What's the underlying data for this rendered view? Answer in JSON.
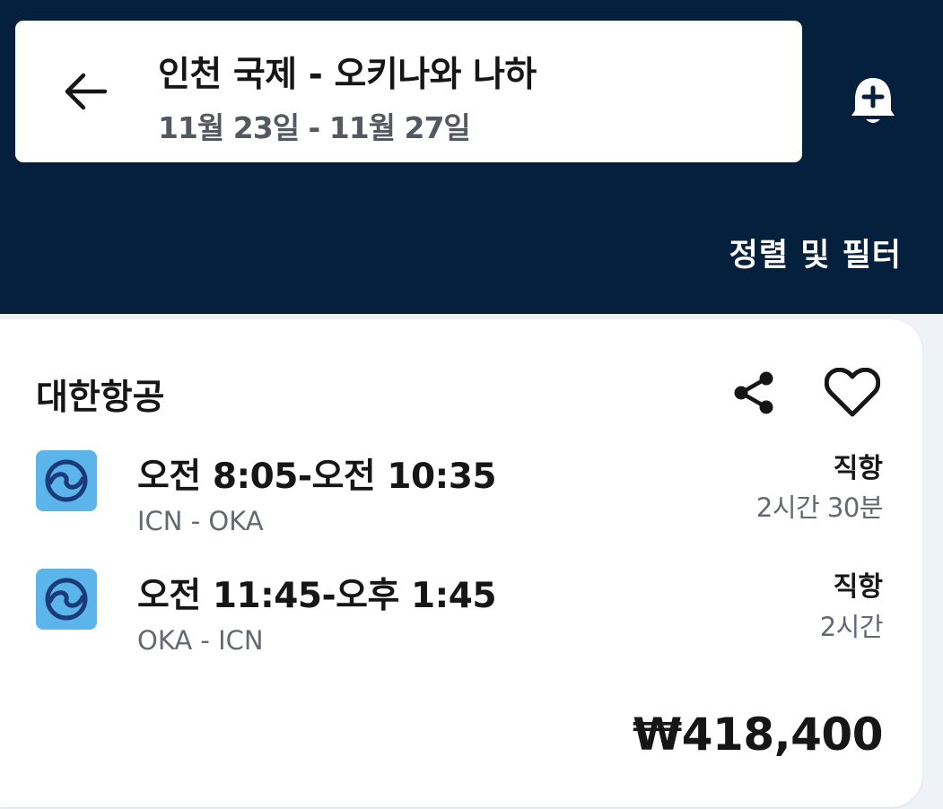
{
  "header": {
    "route_title": "인천 국제 - 오키나와 나하",
    "dates": "11월 23일 - 11월 27일",
    "sort_filter_label": "정렬 및 필터",
    "background_color": "#05203c"
  },
  "icons": {
    "back": "arrow-left-icon",
    "price_alert": "bell-plus-icon",
    "share": "share-icon",
    "favorite": "heart-icon",
    "airline_logo": "korean-air-logo"
  },
  "result": {
    "airline": "대한항공",
    "legs": [
      {
        "times": "오전 8:05-오전 10:35",
        "route": "ICN - OKA",
        "stops": "직항",
        "duration": "2시간 30분"
      },
      {
        "times": "오전 11:45-오후 1:45",
        "route": "OKA - ICN",
        "stops": "직항",
        "duration": "2시간"
      }
    ],
    "price": "₩418,400"
  },
  "colors": {
    "logo_bg": "#5cb5ea",
    "logo_mark": "#1a3a7a"
  }
}
